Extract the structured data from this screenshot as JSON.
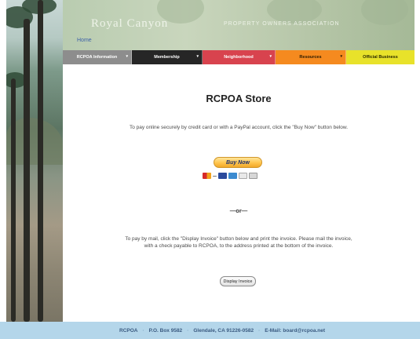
{
  "header": {
    "site_title": "Royal Canyon",
    "site_subtitle": "PROPERTY OWNERS ASSOCIATION",
    "home_link": "Home"
  },
  "nav": {
    "items": [
      {
        "label": "RCPOA Information"
      },
      {
        "label": "Membership"
      },
      {
        "label": "Neighborhood"
      },
      {
        "label": "Resources"
      },
      {
        "label": "Official Business"
      }
    ],
    "colors": [
      "#8d8d8d",
      "#262626",
      "#d8434e",
      "#f58a1f",
      "#e8e22a"
    ]
  },
  "main": {
    "title": "RCPOA Store",
    "online_text": "To pay online securely by credit card or with a PayPal account, click the \"Buy Now\" button below.",
    "buy_button": "Buy Now",
    "payment_icons": [
      "mastercard-icon",
      "visa-icon",
      "amex-icon",
      "discover-icon",
      "bank-icon"
    ],
    "or_text": "—or—",
    "mail_text": "To pay by mail, click the \"Display Invoice\" button below and print the invoice.  Please mail the invoice, with a check payable to RCPOA, to the address printed at the bottom of the invoice.",
    "invoice_button": "Display Invoice"
  },
  "footer": {
    "org": "RCPOA",
    "po_box": "P.O. Box 9582",
    "city": "Glendale, CA 91226-0582",
    "email_label": "E-Mail:",
    "email": "board@rcpoa.net"
  }
}
